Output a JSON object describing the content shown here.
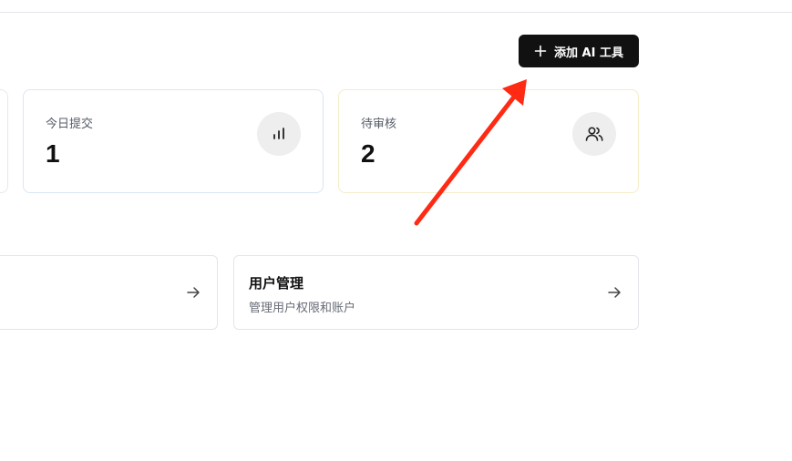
{
  "header": {
    "add_tool_button": {
      "label": "添加 AI 工具",
      "icon": "plus-icon"
    }
  },
  "stats": [
    {
      "label": "今日提交",
      "value": "1",
      "icon": "bar-chart-icon"
    },
    {
      "label": "待审核",
      "value": "2",
      "icon": "users-icon"
    }
  ],
  "links": [
    {
      "title": "用户管理",
      "description": "管理用户权限和账户",
      "icon": "arrow-right-icon"
    }
  ],
  "colors": {
    "button_bg": "#111111",
    "annotation_arrow": "#ff2a14",
    "icon_circle_bg": "#eeeeee"
  }
}
